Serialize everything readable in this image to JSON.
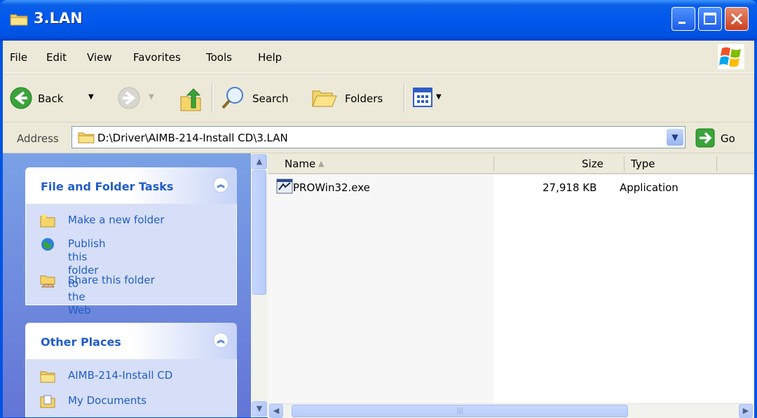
{
  "window": {
    "title": "3.LAN"
  },
  "menu": [
    "File",
    "Edit",
    "View",
    "Favorites",
    "Tools",
    "Help"
  ],
  "toolbar": {
    "back": "Back",
    "search": "Search",
    "folders": "Folders"
  },
  "address": {
    "label": "Address",
    "path": "D:\\Driver\\AIMB-214-Install CD\\3.LAN",
    "go": "Go"
  },
  "tasks_panel": {
    "title": "File and Folder Tasks",
    "items": [
      {
        "label": "Make a new folder",
        "icon": "new-folder-icon"
      },
      {
        "label": "Publish this folder to\nthe Web",
        "icon": "publish-web-icon"
      },
      {
        "label": "Share this folder",
        "icon": "share-folder-icon"
      }
    ]
  },
  "places_panel": {
    "title": "Other Places",
    "items": [
      {
        "label": "AIMB-214-Install CD",
        "icon": "folder-icon"
      },
      {
        "label": "My Documents",
        "icon": "my-documents-icon"
      }
    ]
  },
  "file_list": {
    "columns": {
      "name": "Name",
      "size": "Size",
      "type": "Type"
    },
    "rows": [
      {
        "name": "PROWin32.exe",
        "size": "27,918 KB",
        "type": "Application",
        "icon": "application-exe-icon"
      }
    ]
  }
}
